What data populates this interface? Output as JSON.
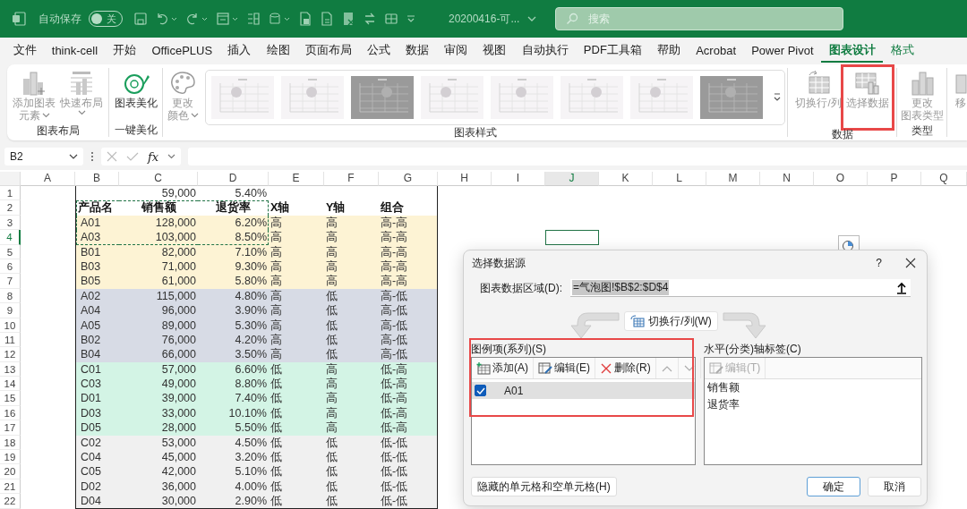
{
  "title_bar": {
    "autosave_label": "自动保存",
    "autosave": {
      "on": false,
      "label": "关"
    },
    "file_name": "20200416-可...",
    "search": {
      "placeholder": "搜索"
    }
  },
  "tabs": [
    {
      "label": "文件",
      "selected": false,
      "contextual": false
    },
    {
      "label": "think-cell",
      "selected": false,
      "contextual": false
    },
    {
      "label": "开始",
      "selected": false,
      "contextual": false
    },
    {
      "label": "OfficePLUS",
      "selected": false,
      "contextual": false
    },
    {
      "label": "插入",
      "selected": false,
      "contextual": false
    },
    {
      "label": "绘图",
      "selected": false,
      "contextual": false
    },
    {
      "label": "页面布局",
      "selected": false,
      "contextual": false
    },
    {
      "label": "公式",
      "selected": false,
      "contextual": false
    },
    {
      "label": "数据",
      "selected": false,
      "contextual": false
    },
    {
      "label": "审阅",
      "selected": false,
      "contextual": false
    },
    {
      "label": "视图",
      "selected": false,
      "contextual": false
    },
    {
      "label": "自动执行",
      "selected": false,
      "contextual": false
    },
    {
      "label": "PDF工具箱",
      "selected": false,
      "contextual": false
    },
    {
      "label": "帮助",
      "selected": false,
      "contextual": false
    },
    {
      "label": "Acrobat",
      "selected": false,
      "contextual": false
    },
    {
      "label": "Power Pivot",
      "selected": false,
      "contextual": false
    },
    {
      "label": "图表设计",
      "selected": true,
      "contextual": true
    },
    {
      "label": "格式",
      "selected": false,
      "contextual": true
    }
  ],
  "ribbon": {
    "groups": [
      {
        "label": "图表布局",
        "buttons": [
          {
            "lines": [
              "添加图表",
              "元素"
            ],
            "dropdown": true,
            "disabled": true,
            "highlighted": false
          },
          {
            "lines": [
              "快速布局"
            ],
            "dropdown": true,
            "disabled": true,
            "highlighted": false
          }
        ]
      },
      {
        "label": "一键美化",
        "buttons": [
          {
            "lines": [
              "图表美化"
            ],
            "dropdown": false,
            "disabled": false,
            "highlighted": false
          }
        ]
      },
      {
        "label": "图表样式",
        "buttons": [
          {
            "lines": [
              "更改",
              "颜色"
            ],
            "dropdown": true,
            "disabled": true,
            "highlighted": false
          }
        ],
        "styles": [
          {
            "kind": "light"
          },
          {
            "kind": "light"
          },
          {
            "kind": "dark"
          },
          {
            "kind": "light"
          },
          {
            "kind": "light"
          },
          {
            "kind": "light"
          },
          {
            "kind": "light"
          },
          {
            "kind": "dark"
          }
        ]
      },
      {
        "label": "数据",
        "buttons": [
          {
            "lines": [
              "切换行/列"
            ],
            "dropdown": false,
            "disabled": true,
            "highlighted": false
          },
          {
            "lines": [
              "选择数据"
            ],
            "dropdown": false,
            "disabled": true,
            "highlighted": true
          }
        ]
      },
      {
        "label": "类型",
        "buttons": [
          {
            "lines": [
              "更改",
              "图表类型"
            ],
            "dropdown": false,
            "disabled": true,
            "highlighted": false
          }
        ]
      },
      {
        "buttons": [
          {
            "lines": [
              "移"
            ],
            "dropdown": false,
            "disabled": true,
            "highlighted": false
          }
        ]
      }
    ]
  },
  "formula_bar": {
    "name_box": "B2",
    "function_label": "fx"
  },
  "sheet": {
    "columns": [
      {
        "letter": "A",
        "active": false
      },
      {
        "letter": "B",
        "active": false
      },
      {
        "letter": "C",
        "active": false
      },
      {
        "letter": "D",
        "active": false
      },
      {
        "letter": "E",
        "active": false
      },
      {
        "letter": "F",
        "active": false
      },
      {
        "letter": "G",
        "active": false
      },
      {
        "letter": "H",
        "active": false
      },
      {
        "letter": "I",
        "active": false
      },
      {
        "letter": "J",
        "active": true
      },
      {
        "letter": "K",
        "active": false
      },
      {
        "letter": "L",
        "active": false
      },
      {
        "letter": "M",
        "active": false
      },
      {
        "letter": "N",
        "active": false
      },
      {
        "letter": "O",
        "active": false
      },
      {
        "letter": "P",
        "active": false
      },
      {
        "letter": "Q",
        "active": false
      }
    ],
    "rows": [
      {
        "number": "1",
        "sales": "59,000",
        "rate": "5.40%",
        "bold": false,
        "selected": false,
        "marquee": false
      },
      {
        "number": "2",
        "name": "产品名",
        "sales": "销售额",
        "rate": "退货率",
        "x": "X轴",
        "y": "Y轴",
        "combo": "组合",
        "bold": true,
        "selected": false,
        "marquee": true
      },
      {
        "number": "3",
        "name": "A01",
        "sales": "128,000",
        "rate": "6.20%",
        "x": "高",
        "y": "高",
        "combo": "高-高",
        "bold": false,
        "selected": false,
        "marquee": true,
        "color": "#fdf3d4"
      },
      {
        "number": "4",
        "name": "A03",
        "sales": "103,000",
        "rate": "8.50%",
        "x": "高",
        "y": "高",
        "combo": "高-高",
        "bold": false,
        "selected": true,
        "marquee": true,
        "color": "#fdf3d4"
      },
      {
        "number": "5",
        "name": "B01",
        "sales": "82,000",
        "rate": "7.10%",
        "x": "高",
        "y": "高",
        "combo": "高-高",
        "bold": false,
        "selected": false,
        "marquee": false,
        "color": "#fdf3d4"
      },
      {
        "number": "6",
        "name": "B03",
        "sales": "71,000",
        "rate": "9.30%",
        "x": "高",
        "y": "高",
        "combo": "高-高",
        "bold": false,
        "selected": false,
        "marquee": false,
        "color": "#fdf3d4"
      },
      {
        "number": "7",
        "name": "B05",
        "sales": "61,000",
        "rate": "5.80%",
        "x": "高",
        "y": "高",
        "combo": "高-高",
        "bold": false,
        "selected": false,
        "marquee": false,
        "color": "#fdf3d4"
      },
      {
        "number": "8",
        "name": "A02",
        "sales": "115,000",
        "rate": "4.80%",
        "x": "高",
        "y": "低",
        "combo": "高-低",
        "bold": false,
        "selected": false,
        "marquee": false,
        "color": "#d7dbe5"
      },
      {
        "number": "9",
        "name": "A04",
        "sales": "96,000",
        "rate": "3.90%",
        "x": "高",
        "y": "低",
        "combo": "高-低",
        "bold": false,
        "selected": false,
        "marquee": false,
        "color": "#d7dbe5"
      },
      {
        "number": "10",
        "name": "A05",
        "sales": "89,000",
        "rate": "5.30%",
        "x": "高",
        "y": "低",
        "combo": "高-低",
        "bold": false,
        "selected": false,
        "marquee": false,
        "color": "#d7dbe5"
      },
      {
        "number": "11",
        "name": "B02",
        "sales": "76,000",
        "rate": "4.20%",
        "x": "高",
        "y": "低",
        "combo": "高-低",
        "bold": false,
        "selected": false,
        "marquee": false,
        "color": "#d7dbe5"
      },
      {
        "number": "12",
        "name": "B04",
        "sales": "66,000",
        "rate": "3.50%",
        "x": "高",
        "y": "低",
        "combo": "高-低",
        "bold": false,
        "selected": false,
        "marquee": false,
        "color": "#d7dbe5"
      },
      {
        "number": "13",
        "name": "C01",
        "sales": "57,000",
        "rate": "6.60%",
        "x": "低",
        "y": "高",
        "combo": "低-高",
        "bold": false,
        "selected": false,
        "marquee": false,
        "color": "#d3f4e5"
      },
      {
        "number": "14",
        "name": "C03",
        "sales": "49,000",
        "rate": "8.80%",
        "x": "低",
        "y": "高",
        "combo": "低-高",
        "bold": false,
        "selected": false,
        "marquee": false,
        "color": "#d3f4e5"
      },
      {
        "number": "15",
        "name": "D01",
        "sales": "39,000",
        "rate": "7.40%",
        "x": "低",
        "y": "高",
        "combo": "低-高",
        "bold": false,
        "selected": false,
        "marquee": false,
        "color": "#d3f4e5"
      },
      {
        "number": "16",
        "name": "D03",
        "sales": "33,000",
        "rate": "10.10%",
        "x": "低",
        "y": "高",
        "combo": "低-高",
        "bold": false,
        "selected": false,
        "marquee": false,
        "color": "#d3f4e5"
      },
      {
        "number": "17",
        "name": "D05",
        "sales": "28,000",
        "rate": "5.50%",
        "x": "低",
        "y": "高",
        "combo": "低-高",
        "bold": false,
        "selected": false,
        "marquee": false,
        "color": "#d3f4e5"
      },
      {
        "number": "18",
        "name": "C02",
        "sales": "53,000",
        "rate": "4.50%",
        "x": "低",
        "y": "低",
        "combo": "低-低",
        "bold": false,
        "selected": false,
        "marquee": false,
        "color": "#f0f0f0"
      },
      {
        "number": "19",
        "name": "C04",
        "sales": "45,000",
        "rate": "3.20%",
        "x": "低",
        "y": "低",
        "combo": "低-低",
        "bold": false,
        "selected": false,
        "marquee": false,
        "color": "#f0f0f0"
      },
      {
        "number": "20",
        "name": "C05",
        "sales": "42,000",
        "rate": "5.10%",
        "x": "低",
        "y": "低",
        "combo": "低-低",
        "bold": false,
        "selected": false,
        "marquee": false,
        "color": "#f0f0f0"
      },
      {
        "number": "21",
        "name": "D02",
        "sales": "36,000",
        "rate": "4.00%",
        "x": "低",
        "y": "低",
        "combo": "低-低",
        "bold": false,
        "selected": false,
        "marquee": false,
        "color": "#f0f0f0"
      },
      {
        "number": "22",
        "name": "D04",
        "sales": "30,000",
        "rate": "2.90%",
        "x": "低",
        "y": "低",
        "combo": "低-低",
        "bold": false,
        "selected": false,
        "marquee": false,
        "color": "#f0f0f0"
      }
    ]
  },
  "dialog": {
    "title": "选择数据源",
    "help": "?",
    "range": {
      "label": "图表数据区域(D):",
      "value": "=气泡图!$B$2:$D$4"
    },
    "switch_button": "切换行/列(W)",
    "series_panel": {
      "label": "图例项(系列)(S)",
      "highlighted": true,
      "tools": [
        {
          "label": "添加(A)",
          "disabled": false
        },
        {
          "label": "编辑(E)",
          "disabled": false
        },
        {
          "label": "删除(R)",
          "disabled": false
        }
      ],
      "move_up": {
        "disabled": true
      },
      "move_down": {
        "disabled": true
      },
      "items": [
        {
          "label": "A01",
          "checked": true,
          "selected": true
        }
      ]
    },
    "axis_panel": {
      "label": "水平(分类)轴标签(C)",
      "edit": {
        "label": "编辑(T)",
        "disabled": true
      },
      "items": [
        {
          "label": "销售额"
        },
        {
          "label": "退货率"
        }
      ]
    },
    "hidden_cells_button": "隐藏的单元格和空单元格(H)",
    "ok_button": "确定",
    "cancel_button": "取消"
  }
}
